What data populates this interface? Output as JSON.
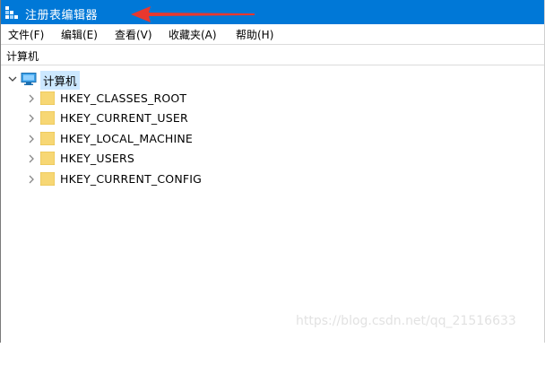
{
  "window": {
    "title": "注册表编辑器"
  },
  "menu": [
    "文件(F)",
    "编辑(E)",
    "查看(V)",
    "收藏夹(A)",
    "帮助(H)"
  ],
  "address": "计算机",
  "tree": {
    "root_label": "计算机",
    "keys": [
      "HKEY_CLASSES_ROOT",
      "HKEY_CURRENT_USER",
      "HKEY_LOCAL_MACHINE",
      "HKEY_USERS",
      "HKEY_CURRENT_CONFIG"
    ]
  },
  "watermark": "https://blog.csdn.net/qq_21516633",
  "colors": {
    "titlebar": "#0078d7",
    "selection": "#cce8ff",
    "folder": "#f7d774",
    "annotation_arrow": "#e8382e"
  },
  "icons": {
    "app": "regedit-icon",
    "computer": "computer-icon",
    "folder": "folder-icon",
    "arrow": "red-arrow-annotation"
  }
}
